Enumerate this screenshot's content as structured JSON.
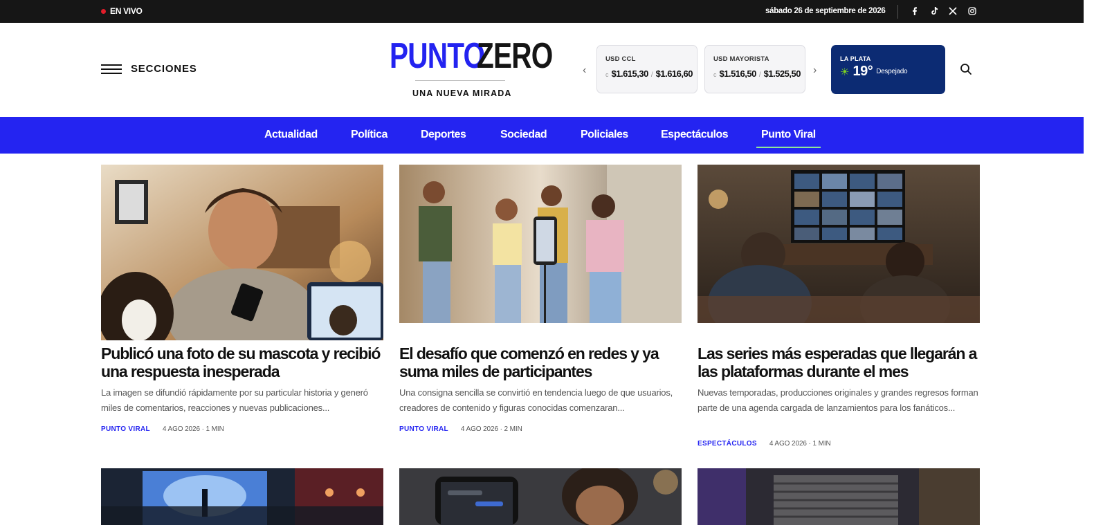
{
  "topbar": {
    "live_label": "EN VIVO",
    "date": "sábado 26 de septiembre de 2026",
    "social_icons": [
      "facebook-icon",
      "tiktok-icon",
      "x-icon",
      "instagram-icon"
    ]
  },
  "header": {
    "menu_label": "SECCIONES",
    "logo_part1": "PUNTO",
    "logo_part2": "ZERO",
    "tagline": "UNA NUEVA MIRADA",
    "fx": [
      {
        "title": "USD CCL",
        "prefix": "c",
        "buy": "$1.615,30",
        "sell": "$1.616,60"
      },
      {
        "title": "USD MAYORISTA",
        "prefix": "c",
        "buy": "$1.516,50",
        "sell": "$1.525,50"
      }
    ],
    "weather": {
      "city": "LA PLATA",
      "temp": "19°",
      "desc": "Despejado",
      "icon": "sun-icon"
    }
  },
  "nav": {
    "items": [
      "Actualidad",
      "Política",
      "Deportes",
      "Sociedad",
      "Policiales",
      "Espectáculos",
      "Punto Viral"
    ],
    "active": "Punto Viral"
  },
  "colors": {
    "brand_blue": "#2424f1",
    "topbar_bg": "#161616",
    "weather_bg": "#0c2b73",
    "live_dot": "#e11d2a",
    "nav_active_underline": "#8ee59a"
  },
  "articles": [
    {
      "title": "Publicó una foto de su mascota y recibió una respuesta inesperada",
      "excerpt": "La imagen se difundió rápidamente por su particular historia y generó miles de comentarios, reacciones y nuevas publicaciones...",
      "category": "PUNTO VIRAL",
      "date": "4 AGO 2026 · 1 MIN"
    },
    {
      "title": "El desafío que comenzó en redes y ya suma miles de participantes",
      "excerpt": "Una consigna sencilla se convirtió en tendencia luego de que usuarios, creadores de contenido y figuras conocidas comenzaran...",
      "category": "PUNTO VIRAL",
      "date": "4 AGO 2026 · 2 MIN"
    },
    {
      "title": "Las series más esperadas que llegarán a las plataformas durante el mes",
      "excerpt": "Nuevas temporadas, producciones originales y grandes regresos forman parte de una agenda cargada de lanzamientos para los fanáticos...",
      "category": "ESPECTÁCULOS",
      "date": "4 AGO 2026 · 1 MIN"
    }
  ]
}
